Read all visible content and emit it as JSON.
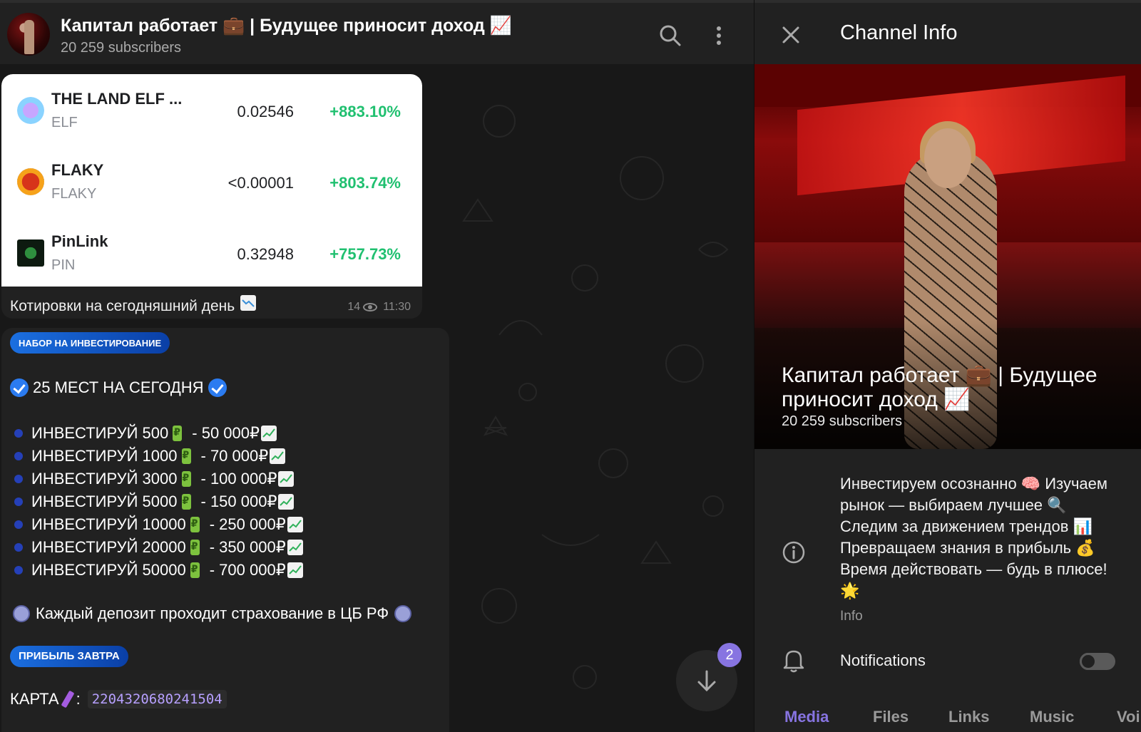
{
  "chat": {
    "title": "Капитал работает 💼 | Будущее приносит доход 📈",
    "subscribers": "20 259 subscribers"
  },
  "quotes": {
    "rows": [
      {
        "name": "THE LAND ELF ...",
        "symbol": "ELF",
        "price": "0.02546",
        "change": "+883.10%"
      },
      {
        "name": "FLAKY",
        "symbol": "FLAKY",
        "price": "<0.00001",
        "change": "+803.74%"
      },
      {
        "name": "PinLink",
        "symbol": "PIN",
        "price": "0.32948",
        "change": "+757.73%"
      }
    ],
    "caption": "Котировки на сегодняшний день",
    "views": "14",
    "time": "11:30"
  },
  "invest": {
    "badge": "НАБОР НА ИНВЕСТИРОВАНИЕ",
    "seats": "25 МЕСТ НА СЕГОДНЯ",
    "items": [
      {
        "amount": "ИНВЕСТИРУЙ 500",
        "result": "-  50 000₽"
      },
      {
        "amount": "ИНВЕСТИРУЙ 1000",
        "result": "- 70 000₽"
      },
      {
        "amount": "ИНВЕСТИРУЙ 3000",
        "result": "- 100 000₽"
      },
      {
        "amount": "ИНВЕСТИРУЙ 5000",
        "result": "- 150 000₽"
      },
      {
        "amount": "ИНВЕСТИРУЙ 10000",
        "result": "- 250 000₽"
      },
      {
        "amount": "ИНВЕСТИРУЙ 20000",
        "result": "- 350 000₽"
      },
      {
        "amount": "ИНВЕСТИРУЙ 50000",
        "result": "- 700 000₽"
      }
    ],
    "insurance": "Каждый депозит проходит страхование в ЦБ РФ",
    "profit_badge": "ПРИБЫЛЬ ЗАВТРА",
    "card_label": "КАРТА",
    "card_number": "2204320680241504"
  },
  "scroll": {
    "unread": "2"
  },
  "info": {
    "title": "Channel Info",
    "channel_name": "Капитал работает 💼 | Будущее приносит доход 📈",
    "subscribers": "20 259 subscribers",
    "description": "Инвестируем осознанно 🧠 Изучаем рынок — выбираем лучшее 🔍 Следим за движением трендов 📊 Превращаем знания в прибыль 💰 Время действовать — будь в плюсе! 🌟",
    "description_label": "Info",
    "notifications_label": "Notifications",
    "tabs": [
      "Media",
      "Files",
      "Links",
      "Music",
      "Voi"
    ]
  },
  "colors": {
    "accent": "#8774e1",
    "positive": "#20c070",
    "badge_blue": "#1b6fe0"
  },
  "icons": {
    "header": [
      "search-icon",
      "more-vertical-icon"
    ],
    "info": [
      "close-icon",
      "info-icon",
      "bell-icon",
      "arrow-down-icon"
    ]
  }
}
